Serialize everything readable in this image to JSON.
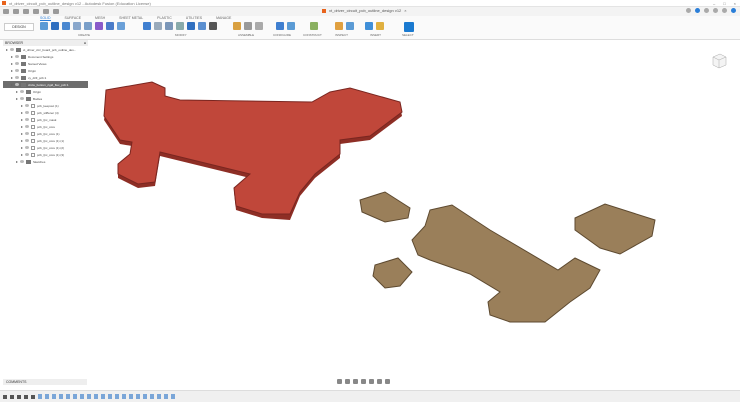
{
  "window": {
    "title": "xt_driver_circuit_pcb_outline_design v12 - Autodesk Fusion (Education License)"
  },
  "document_tab": {
    "label": "xt_driver_circuit_pcb_outline_design v12"
  },
  "ribbon": {
    "workspace": "DESIGN",
    "tabs": [
      {
        "label": "SOLID",
        "active": true
      },
      {
        "label": "SURFACE"
      },
      {
        "label": "MESH"
      },
      {
        "label": "SHEET METAL"
      },
      {
        "label": "PLASTIC"
      },
      {
        "label": "UTILITIES"
      },
      {
        "label": "MANAGE"
      }
    ],
    "groups": [
      "CREATE",
      "MODIFY",
      "ASSEMBLE",
      "CONFIGURE",
      "CONSTRUCT",
      "INSPECT",
      "INSERT",
      "SELECT"
    ]
  },
  "browser": {
    "title": "BROWSER",
    "nodes": [
      {
        "label": "xt_driver_circ_board_pcb_outline_des...",
        "level": 0
      },
      {
        "label": "Document Settings",
        "level": 1
      },
      {
        "label": "Named Views",
        "level": 1
      },
      {
        "label": "Origin",
        "level": 1
      },
      {
        "label": "xy_drill_pcb:1",
        "level": 1
      },
      {
        "label": "circle_bottom_rigid_flex_pcb:1",
        "level": 1,
        "selected": true
      },
      {
        "label": "Origin",
        "level": 2
      },
      {
        "label": "Bodies",
        "level": 2
      },
      {
        "label": "pcb_keepout (1)",
        "level": 3
      },
      {
        "label": "pcb_stiffener (4)",
        "level": 3
      },
      {
        "label": "pcb_fpc_mask",
        "level": 3
      },
      {
        "label": "pcb_fpc_core",
        "level": 3
      },
      {
        "label": "pcb_fpc_core (1)",
        "level": 3
      },
      {
        "label": "pcb_fpc_core (1) (1)",
        "level": 3
      },
      {
        "label": "pcb_fpc_core (1) (2)",
        "level": 3
      },
      {
        "label": "pcb_fpc_core (1) (3)",
        "level": 3
      },
      {
        "label": "Sketches",
        "level": 2
      }
    ]
  },
  "comments": {
    "label": "COMMENTS"
  },
  "colors": {
    "red_part": "#c0473a",
    "tan_part": "#9a7f5a",
    "accent": "#2a7ed8"
  }
}
